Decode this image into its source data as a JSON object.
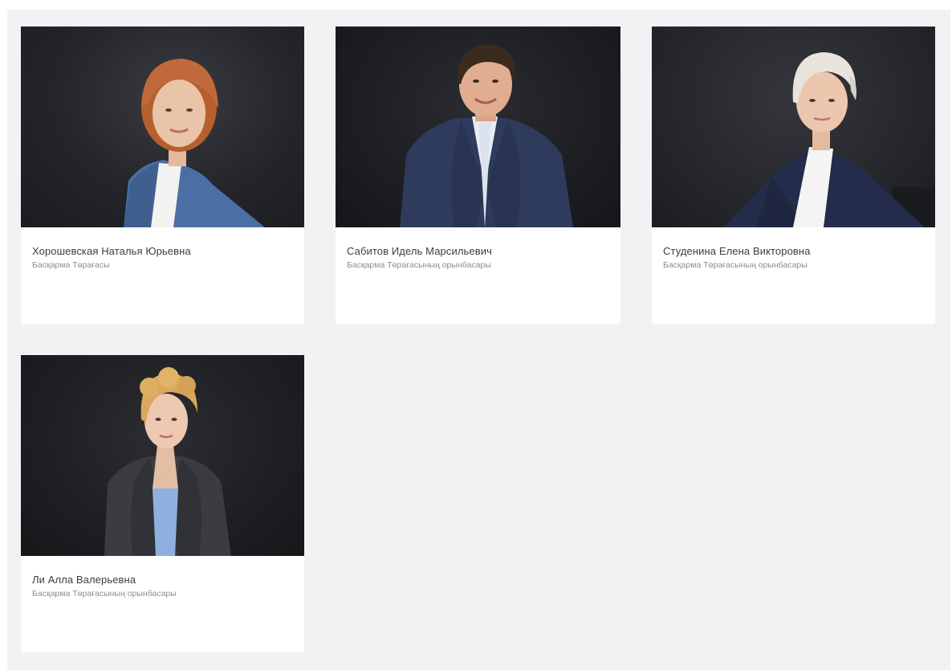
{
  "people": [
    {
      "name": "Хорошевская Наталья Юрьевна",
      "role": "Басқарма Төрағасы",
      "photo_icon": "portrait-woman-red-hair"
    },
    {
      "name": "Сабитов Идель Марсильевич",
      "role": "Басқарма Төрағасының орынбасары",
      "photo_icon": "portrait-man-dark-suit"
    },
    {
      "name": "Студенина Елена Викторовна",
      "role": "Басқарма Төрағасының орынбасары",
      "photo_icon": "portrait-woman-blonde-short"
    },
    {
      "name": "Ли Алла Валерьевна",
      "role": "Басқарма Төрағасының орынбасары",
      "photo_icon": "portrait-woman-blonde-curly"
    }
  ],
  "colors": {
    "panel_background": "#f1f2f4",
    "card_background": "#ffffff",
    "name_text": "#3a3d44",
    "role_text": "#8a8e96"
  }
}
